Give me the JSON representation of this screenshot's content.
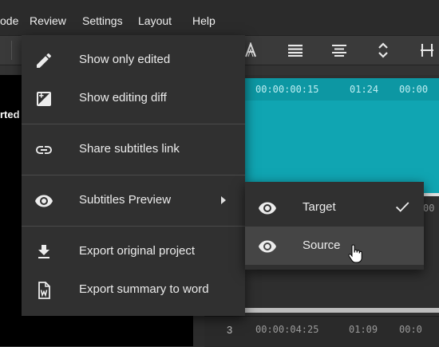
{
  "menubar": {
    "items": [
      "ode",
      "Review",
      "Settings",
      "Layout",
      "Help"
    ]
  },
  "toolbar": {
    "icons": [
      "text-outline-icon",
      "align-justify-icon",
      "align-center-icon",
      "vertical-expand-icon",
      "split-icon"
    ]
  },
  "preview": {
    "fragment": "rted"
  },
  "timeline": {
    "row1": {
      "time": "00:00:00:15",
      "duration": "01:24",
      "next": "00:00"
    },
    "row3": {
      "index": "3",
      "time": "00:00:04:25",
      "duration": "01:09",
      "next": "00:0"
    },
    "peek": "00"
  },
  "menu": {
    "items": [
      {
        "label": "Show only edited",
        "icon": "pencil-icon"
      },
      {
        "label": "Show editing diff",
        "icon": "diff-icon"
      },
      {
        "label": "Share subtitles link",
        "icon": "link-icon"
      },
      {
        "label": "Subtitles Preview",
        "icon": "eye-icon"
      },
      {
        "label": "Export original project",
        "icon": "download-icon"
      },
      {
        "label": "Export summary to word",
        "icon": "word-file-icon"
      }
    ]
  },
  "submenu": {
    "items": [
      {
        "label": "Target",
        "icon": "eye-icon",
        "checked": true
      },
      {
        "label": "Source",
        "icon": "eye-icon",
        "checked": false
      }
    ]
  },
  "colors": {
    "accent": "#10a5b2",
    "menu_bg": "#303030",
    "hover_bg": "#454545"
  }
}
